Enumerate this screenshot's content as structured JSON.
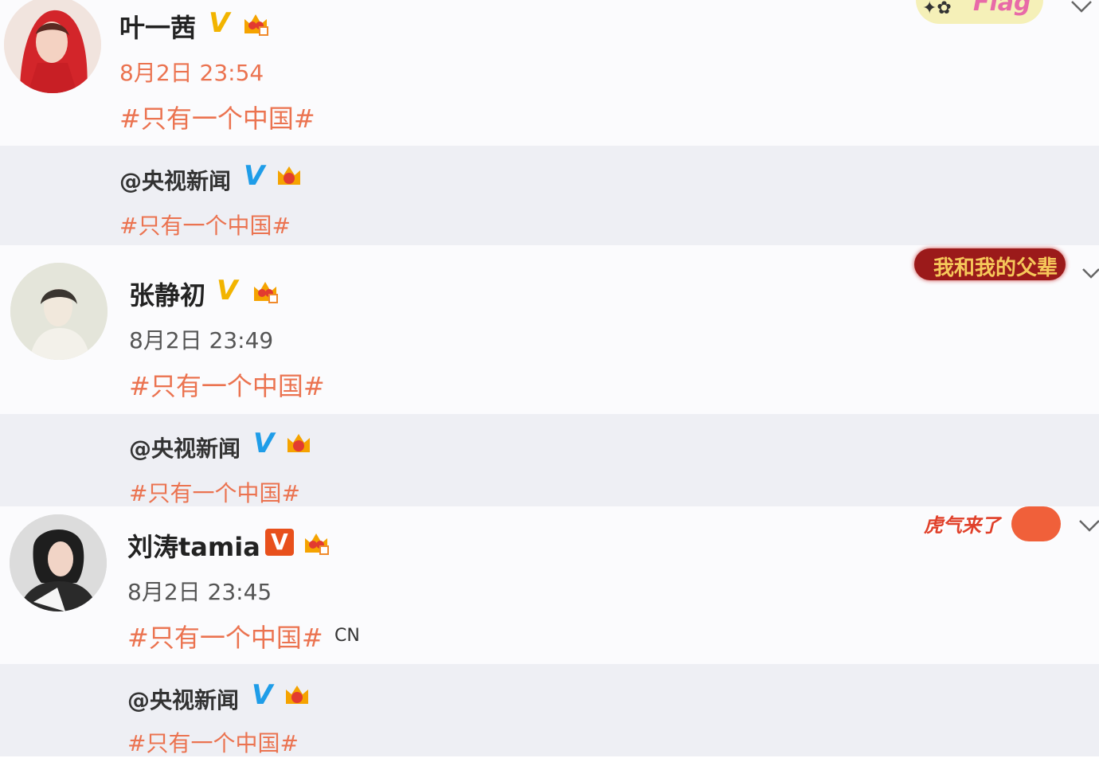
{
  "colors": {
    "topic": "#eb7350",
    "verified_gold": "#f2b400",
    "verified_blue": "#1f9de8",
    "verified_red": "#e8501c",
    "repost_bg": "#eeeff4"
  },
  "posts": [
    {
      "user": "叶一茜",
      "verify_icon": "gold-v-icon",
      "time": "8月2日 23:54",
      "text": "#只有一个中国#",
      "repost": {
        "user": "@央视新闻",
        "text": "#只有一个中国#"
      }
    },
    {
      "user": "张静初",
      "verify_icon": "gold-v-icon",
      "time": "8月2日 23:49",
      "text": "#只有一个中国#",
      "repost": {
        "user": "@央视新闻",
        "text": "#只有一个中国#"
      }
    },
    {
      "user": "刘涛tamia",
      "verify_icon": "red-v-icon",
      "time": "8月2日 23:45",
      "text": "#只有一个中国#",
      "suffix": "CN",
      "repost": {
        "user": "@央视新闻",
        "text": "#只有一个中国#"
      }
    }
  ],
  "decorations": {
    "banner1": "Flag",
    "banner2": "我和我的父辈",
    "banner3": "虎气来了"
  }
}
